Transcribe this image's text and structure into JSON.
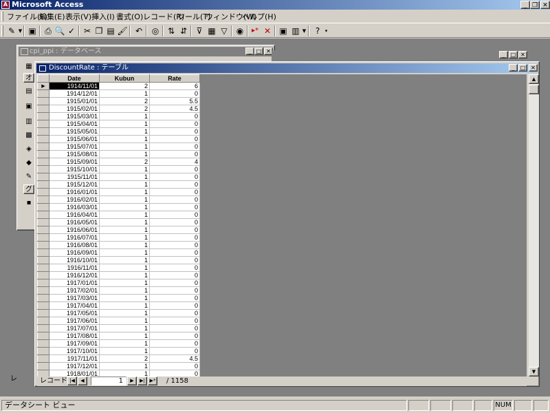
{
  "app": {
    "title": "Microsoft Access"
  },
  "menu": [
    {
      "label": "ファイル(F)"
    },
    {
      "label": "編集(E)"
    },
    {
      "label": "表示(V)"
    },
    {
      "label": "挿入(I)"
    },
    {
      "label": "書式(O)"
    },
    {
      "label": "レコード(R)"
    },
    {
      "label": "ツール(T)"
    },
    {
      "label": "ウィンドウ(W)"
    },
    {
      "label": "ヘルプ(H)"
    }
  ],
  "toolbar": [
    {
      "icon": "design-view-icon",
      "glyph": "✎"
    },
    {
      "icon": "save-icon",
      "glyph": "▣"
    },
    {
      "icon": "print-icon",
      "glyph": "⎙"
    },
    {
      "icon": "print-preview-icon",
      "glyph": "🔍"
    },
    {
      "icon": "spelling-icon",
      "glyph": "✓"
    },
    {
      "icon": "cut-icon",
      "glyph": "✂"
    },
    {
      "icon": "copy-icon",
      "glyph": "❐"
    },
    {
      "icon": "paste-icon",
      "glyph": "▤"
    },
    {
      "icon": "format-painter-icon",
      "glyph": "🖌"
    },
    {
      "icon": "undo-icon",
      "glyph": "↶"
    },
    {
      "icon": "hyperlink-icon",
      "glyph": "◎"
    },
    {
      "icon": "sort-ascending-icon",
      "glyph": "⇅"
    },
    {
      "icon": "sort-descending-icon",
      "glyph": "⇵"
    },
    {
      "icon": "filter-by-selection-icon",
      "glyph": "⊽"
    },
    {
      "icon": "filter-by-form-icon",
      "glyph": "▦"
    },
    {
      "icon": "apply-filter-icon",
      "glyph": "▽"
    },
    {
      "icon": "find-icon",
      "glyph": "◉"
    },
    {
      "icon": "new-record-icon",
      "glyph": "▸*"
    },
    {
      "icon": "delete-record-icon",
      "glyph": "✕"
    },
    {
      "icon": "database-window-icon",
      "glyph": "▣"
    },
    {
      "icon": "new-object-icon",
      "glyph": "▥"
    },
    {
      "icon": "help-icon",
      "glyph": "?"
    }
  ],
  "db_window": {
    "title": "cpi_ppi : データベース",
    "tab_label": "オ",
    "groups_label": "グ",
    "side_label": "レ"
  },
  "table_window": {
    "title": "DiscountRate : テーブル",
    "columns": [
      "Date",
      "Kubun",
      "Rate"
    ],
    "rows": [
      [
        "1914/11/01",
        "2",
        "6"
      ],
      [
        "1914/12/01",
        "1",
        "0"
      ],
      [
        "1915/01/01",
        "2",
        "5.5"
      ],
      [
        "1915/02/01",
        "2",
        "4.5"
      ],
      [
        "1915/03/01",
        "1",
        "0"
      ],
      [
        "1915/04/01",
        "1",
        "0"
      ],
      [
        "1915/05/01",
        "1",
        "0"
      ],
      [
        "1915/06/01",
        "1",
        "0"
      ],
      [
        "1915/07/01",
        "1",
        "0"
      ],
      [
        "1915/08/01",
        "1",
        "0"
      ],
      [
        "1915/09/01",
        "2",
        "4"
      ],
      [
        "1915/10/01",
        "1",
        "0"
      ],
      [
        "1915/11/01",
        "1",
        "0"
      ],
      [
        "1915/12/01",
        "1",
        "0"
      ],
      [
        "1916/01/01",
        "1",
        "0"
      ],
      [
        "1916/02/01",
        "1",
        "0"
      ],
      [
        "1916/03/01",
        "1",
        "0"
      ],
      [
        "1916/04/01",
        "1",
        "0"
      ],
      [
        "1916/05/01",
        "1",
        "0"
      ],
      [
        "1916/06/01",
        "1",
        "0"
      ],
      [
        "1916/07/01",
        "1",
        "0"
      ],
      [
        "1916/08/01",
        "1",
        "0"
      ],
      [
        "1916/09/01",
        "1",
        "0"
      ],
      [
        "1916/10/01",
        "1",
        "0"
      ],
      [
        "1916/11/01",
        "1",
        "0"
      ],
      [
        "1916/12/01",
        "1",
        "0"
      ],
      [
        "1917/01/01",
        "1",
        "0"
      ],
      [
        "1917/02/01",
        "1",
        "0"
      ],
      [
        "1917/03/01",
        "1",
        "0"
      ],
      [
        "1917/04/01",
        "1",
        "0"
      ],
      [
        "1917/05/01",
        "1",
        "0"
      ],
      [
        "1917/06/01",
        "1",
        "0"
      ],
      [
        "1917/07/01",
        "1",
        "0"
      ],
      [
        "1917/08/01",
        "1",
        "0"
      ],
      [
        "1917/09/01",
        "1",
        "0"
      ],
      [
        "1917/10/01",
        "1",
        "0"
      ],
      [
        "1917/11/01",
        "2",
        "4.5"
      ],
      [
        "1917/12/01",
        "1",
        "0"
      ],
      [
        "1918/01/01",
        "1",
        "0"
      ]
    ],
    "current_row_marker": "▶"
  },
  "navigation": {
    "label": "レコード:",
    "current": "1",
    "total": "/ 1158"
  },
  "status": {
    "text": "データシート ビュー",
    "num": "NUM"
  }
}
